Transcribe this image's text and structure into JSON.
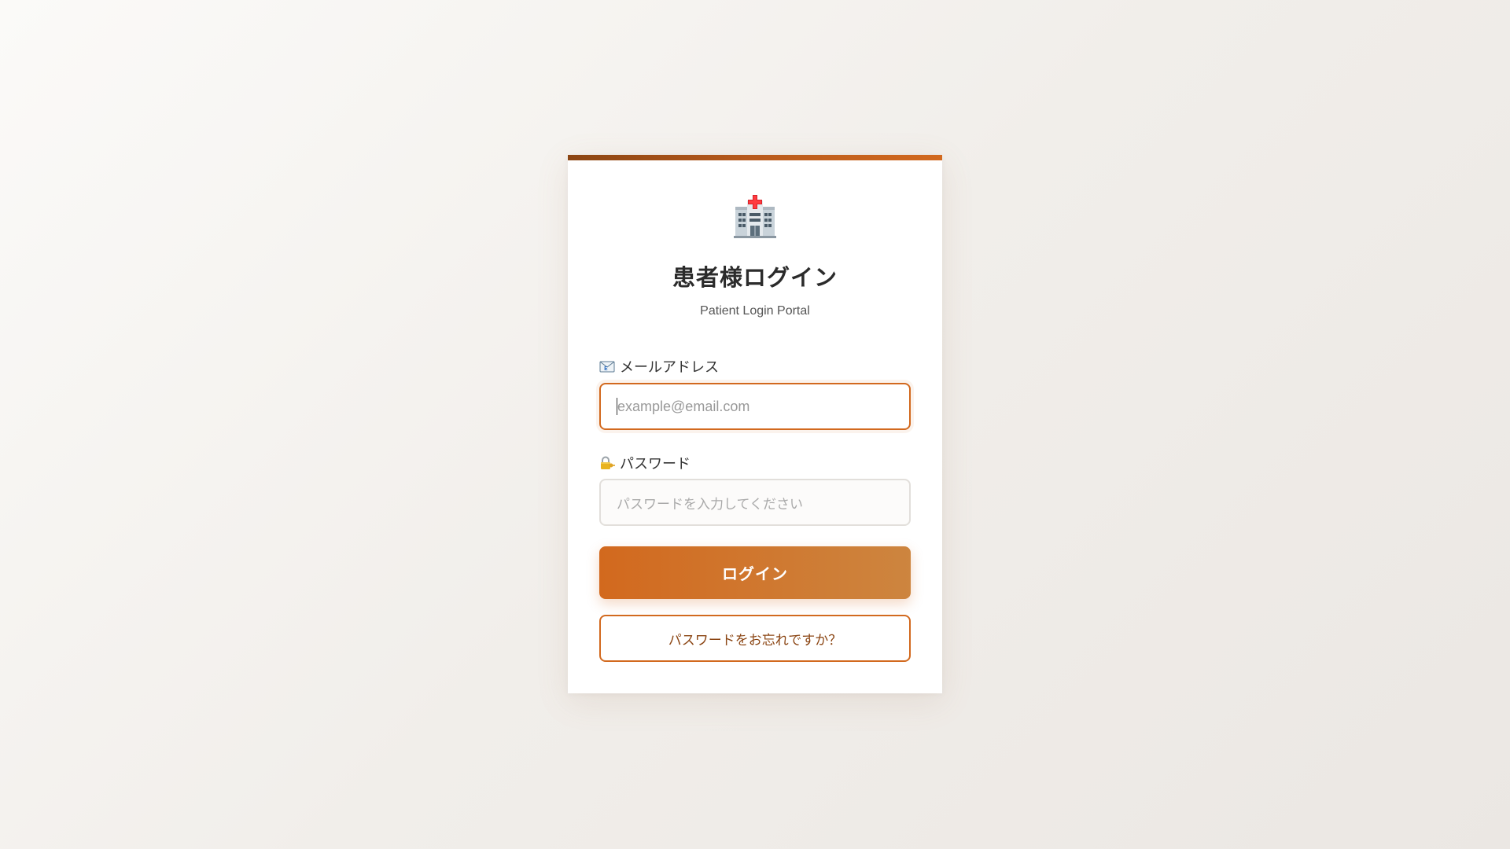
{
  "login": {
    "logo_icon": "hospital-icon",
    "title": "患者様ログイン",
    "subtitle": "Patient Login Portal",
    "email": {
      "icon": "email-icon",
      "label": "メールアドレス",
      "placeholder": "example@email.com",
      "value": ""
    },
    "password": {
      "icon": "locked-with-key-icon",
      "label": "パスワード",
      "placeholder": "パスワードを入力してください",
      "value": ""
    },
    "submit_label": "ログイン",
    "forgot_label": "パスワードをお忘れですか？"
  },
  "colors": {
    "accent": "#d2691e",
    "accent_light": "#cd853f",
    "accent_dark": "#8b4513",
    "background": "#f3f0ec",
    "card": "#ffffff",
    "title_text": "#2b2b2b"
  }
}
